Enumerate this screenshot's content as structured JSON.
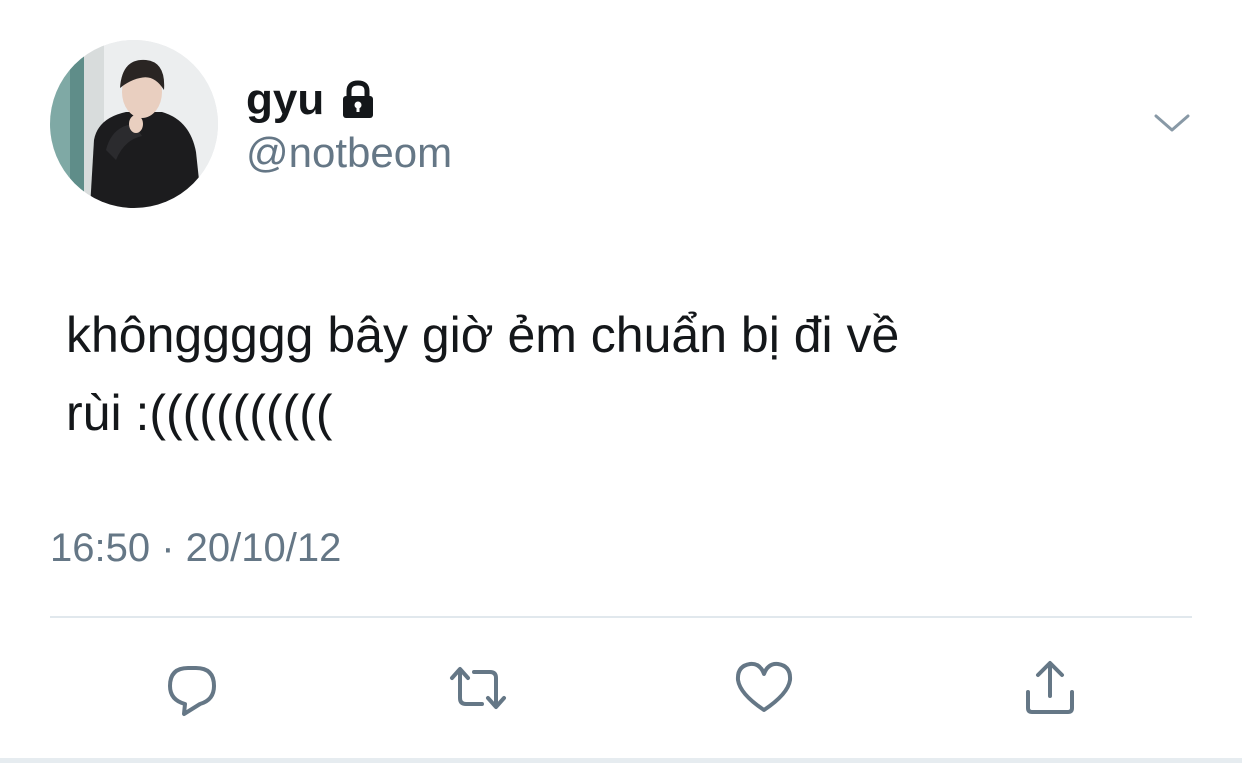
{
  "user": {
    "display_name": "gyu",
    "handle": "@notbeom",
    "protected_icon": "lock-icon"
  },
  "menu": {
    "icon": "chevron-down-icon"
  },
  "tweet": {
    "text": "khônggggg bây giờ ẻm chuẩn bị đi về\nrùi :(((((((((((",
    "timestamp": "16:50 · 20/10/12"
  },
  "actions": [
    {
      "name": "reply",
      "icon": "speech-bubble-icon"
    },
    {
      "name": "retweet",
      "icon": "retweet-arrows-icon"
    },
    {
      "name": "like",
      "icon": "heart-icon"
    },
    {
      "name": "share",
      "icon": "upload-arrow-icon"
    }
  ],
  "colors": {
    "text_primary": "#14171a",
    "text_secondary": "#657786",
    "icon_gray": "#657786",
    "divider": "#e1e8ed"
  }
}
